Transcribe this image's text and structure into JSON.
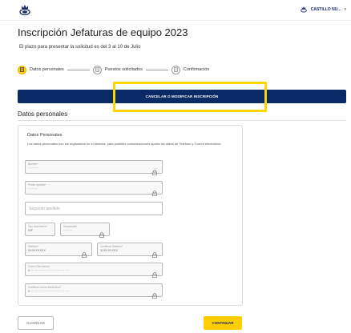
{
  "header": {
    "logo_icon": "postal-crown-logo-icon",
    "user_name": "CASTILLO NU...",
    "user_menu_icon": "chevron-down-icon"
  },
  "page": {
    "title": "Inscripción Jefaturas de equipo 2023",
    "subtitle": "El plazo para presentar la solicitud es del 3 al 10 de Julio"
  },
  "stepper": {
    "steps": [
      {
        "label": "Datos personales",
        "icon": "document-icon",
        "active": true
      },
      {
        "label": "Puestos solicitados",
        "icon": "document-icon",
        "active": false
      },
      {
        "label": "Confirmación",
        "icon": "document-icon",
        "active": false
      }
    ]
  },
  "actions": {
    "cancel_label": "CANCELAR O MODIFICAR INSCRIPCIÓN",
    "save_label": "GUARDAR",
    "continue_label": "CONTINUAR"
  },
  "section": {
    "title": "Datos personales"
  },
  "form": {
    "card_title": "Datos Personales",
    "description": "Los datos personales son los registrados en el sistema, para posibles comunicaciones aporta los datos de Teléfono y Correo electrónico.",
    "fields": {
      "nombre": {
        "label": "Nombre*",
        "value": "··········"
      },
      "primer_apellido": {
        "label": "Primer apellido*",
        "value": "··········"
      },
      "segundo_apellido": {
        "placeholder": "Segundo apellido"
      },
      "tipo_documento": {
        "label": "Tipo documento*",
        "value": "NIF"
      },
      "documento": {
        "label": "Documento*",
        "value": "·········"
      },
      "telefono": {
        "label": "Teléfono*",
        "value": "XXXXXXXXX"
      },
      "confirmar_telefono": {
        "label": "Confirmar Teléfono*",
        "value": "XXXXXXXXX"
      },
      "correo": {
        "label": "Correo Electrónico*",
        "value": "X·······································"
      },
      "confirmar_correo": {
        "label": "Confirmar correo electrónico*",
        "value": "X·······································"
      }
    }
  },
  "colors": {
    "brand_navy": "#0a2a66",
    "brand_yellow": "#ffcd00",
    "highlight": "#ffd700"
  }
}
